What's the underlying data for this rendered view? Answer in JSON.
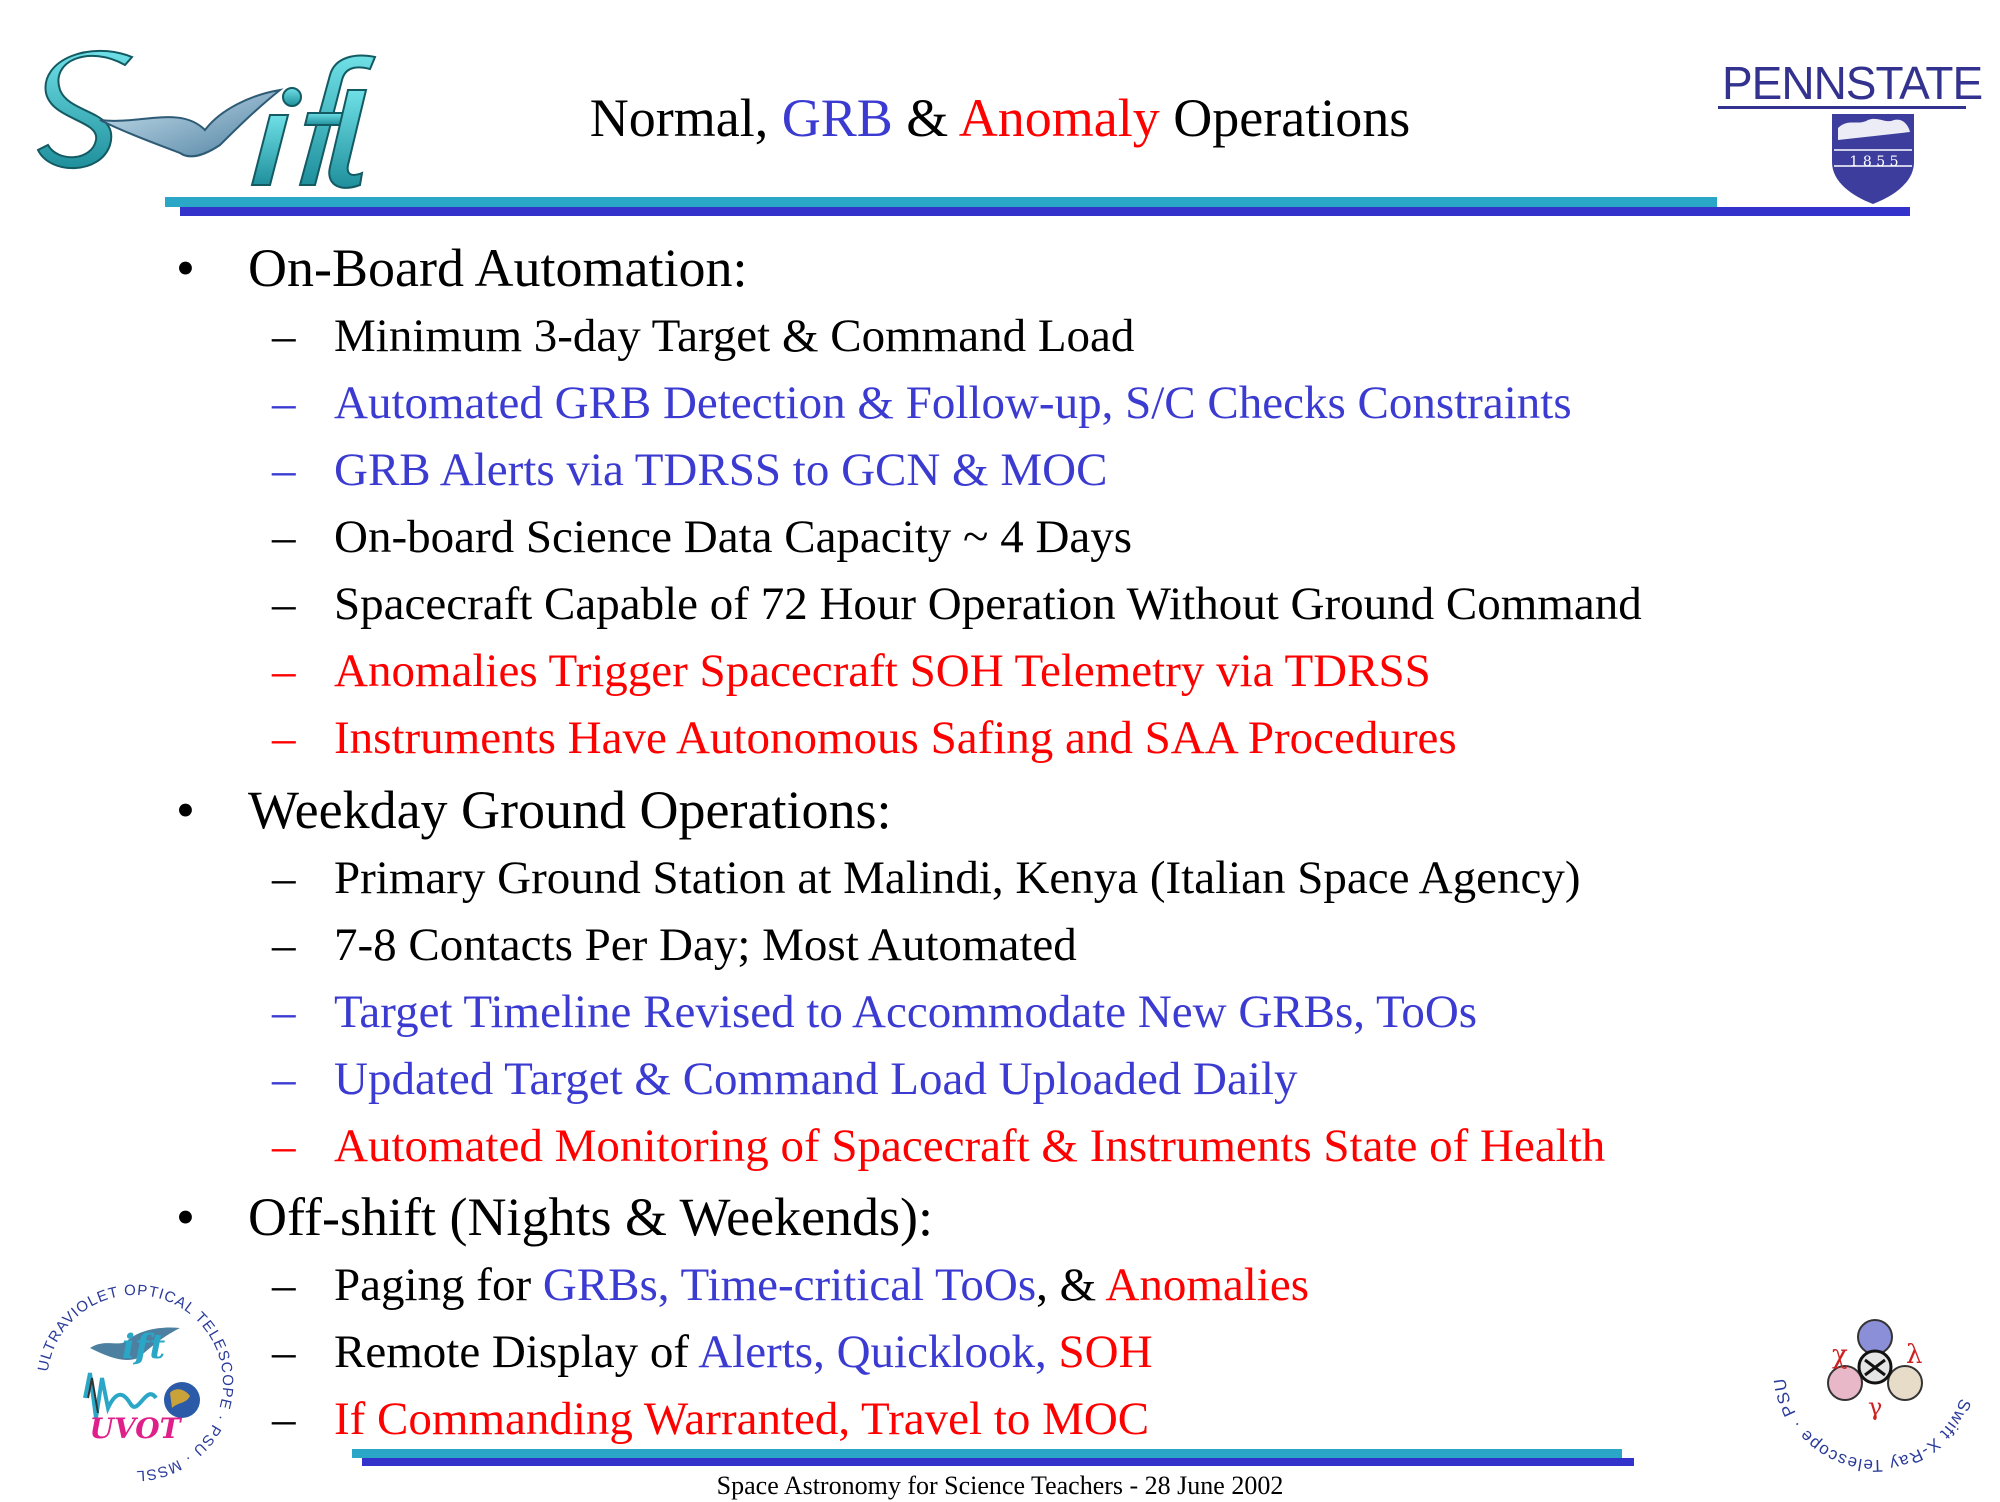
{
  "title": {
    "parts": [
      {
        "text": "Normal, ",
        "color": "black"
      },
      {
        "text": "GRB",
        "color": "blue"
      },
      {
        "text": " & ",
        "color": "black"
      },
      {
        "text": "Anomaly",
        "color": "red"
      },
      {
        "text": " Operations",
        "color": "black"
      }
    ]
  },
  "logos": {
    "swift_top_left": "Swift",
    "pennstate": "PENNSTATE",
    "pennstate_year": "1 8 5 5",
    "uvot_ring": "ULTRAVIOLET OPTICAL TELESCOPE · PSU · MSSL",
    "uvot_label": "UVOT",
    "xrt_ring": "Swift X-Ray Telescope · PSU · LU · OAB"
  },
  "colors": {
    "blue": "#3b3bd2",
    "red": "#ff0000",
    "black": "#000000",
    "rule_cyan": "#2aa7c6",
    "rule_navy": "#3333cc"
  },
  "sections": [
    {
      "heading": "On-Board Automation:",
      "items": [
        {
          "parts": [
            {
              "text": "Minimum 3-day Target & Command Load",
              "color": "black"
            }
          ],
          "dash_color": "black"
        },
        {
          "parts": [
            {
              "text": "Automated GRB Detection & Follow-up, S/C Checks Constraints",
              "color": "blue"
            }
          ],
          "dash_color": "blue"
        },
        {
          "parts": [
            {
              "text": "GRB Alerts via TDRSS to GCN & MOC",
              "color": "blue"
            }
          ],
          "dash_color": "blue"
        },
        {
          "parts": [
            {
              "text": "On-board Science Data Capacity ~ 4 Days",
              "color": "black"
            }
          ],
          "dash_color": "black"
        },
        {
          "parts": [
            {
              "text": "Spacecraft Capable of 72 Hour Operation Without Ground Command",
              "color": "black"
            }
          ],
          "dash_color": "black"
        },
        {
          "parts": [
            {
              "text": "Anomalies Trigger Spacecraft SOH Telemetry via TDRSS",
              "color": "red"
            }
          ],
          "dash_color": "red"
        },
        {
          "parts": [
            {
              "text": "Instruments Have Autonomous Safing and SAA Procedures",
              "color": "red"
            }
          ],
          "dash_color": "red"
        }
      ]
    },
    {
      "heading": "Weekday Ground Operations:",
      "items": [
        {
          "parts": [
            {
              "text": "Primary Ground Station at Malindi, Kenya (Italian Space Agency)",
              "color": "black"
            }
          ],
          "dash_color": "black"
        },
        {
          "parts": [
            {
              "text": "7-8 Contacts Per Day; Most Automated",
              "color": "black"
            }
          ],
          "dash_color": "black"
        },
        {
          "parts": [
            {
              "text": "Target Timeline Revised to Accommodate New GRBs, ToOs",
              "color": "blue"
            }
          ],
          "dash_color": "blue"
        },
        {
          "parts": [
            {
              "text": "Updated Target & Command Load Uploaded Daily",
              "color": "blue"
            }
          ],
          "dash_color": "blue"
        },
        {
          "parts": [
            {
              "text": "Automated Monitoring of Spacecraft & Instruments State of Health",
              "color": "red"
            }
          ],
          "dash_color": "red"
        }
      ]
    },
    {
      "heading": "Off-shift (Nights & Weekends):",
      "items": [
        {
          "parts": [
            {
              "text": "Paging for ",
              "color": "black"
            },
            {
              "text": "GRBs, Time-critical ToOs",
              "color": "blue"
            },
            {
              "text": ", & ",
              "color": "black"
            },
            {
              "text": "Anomalies",
              "color": "red"
            }
          ],
          "dash_color": "black"
        },
        {
          "parts": [
            {
              "text": "Remote Display of ",
              "color": "black"
            },
            {
              "text": "Alerts, Quicklook, ",
              "color": "blue"
            },
            {
              "text": "SOH",
              "color": "red"
            }
          ],
          "dash_color": "black"
        },
        {
          "parts": [
            {
              "text": "If Commanding Warranted, Travel to MOC",
              "color": "red"
            }
          ],
          "dash_color": "black"
        }
      ]
    }
  ],
  "bullet_char": "•",
  "dash_char": "–",
  "footer": "Space Astronomy for Science Teachers -  28 June 2002"
}
